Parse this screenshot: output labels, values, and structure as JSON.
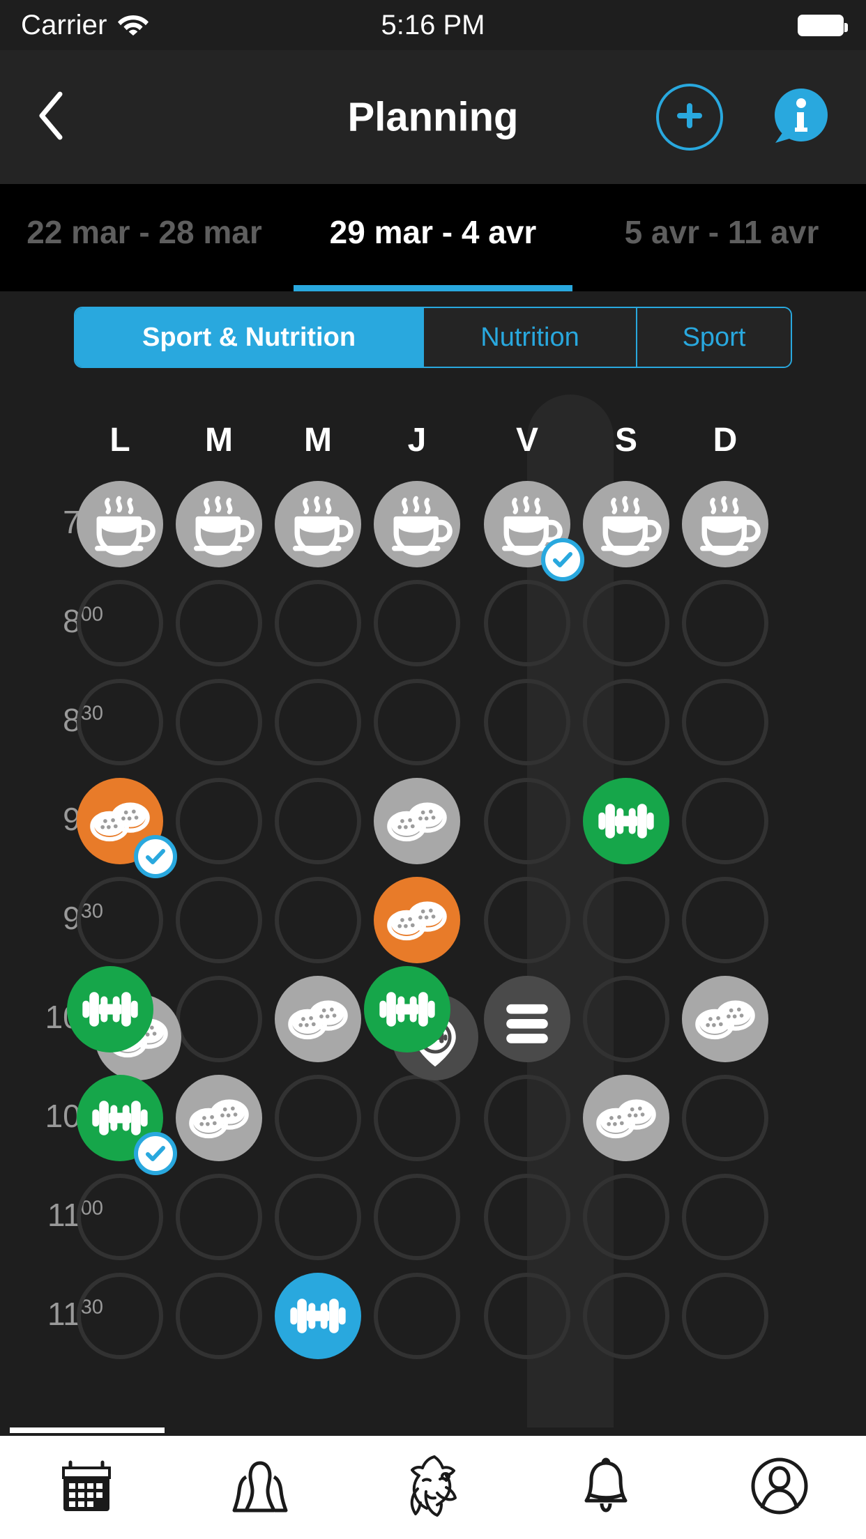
{
  "status_bar": {
    "carrier": "Carrier",
    "wifi_icon": "wifi-icon",
    "time": "5:16 PM",
    "battery_icon": "battery-full-icon"
  },
  "nav": {
    "back_icon": "chevron-left-icon",
    "title": "Planning",
    "add_icon": "plus-circle-icon",
    "info_icon": "info-bubble-icon"
  },
  "week_tabs": [
    {
      "label": "22 mar - 28 mar",
      "active": false
    },
    {
      "label": "29 mar - 4 avr",
      "active": true
    },
    {
      "label": "5 avr - 11 avr",
      "active": false
    }
  ],
  "segments": [
    {
      "label": "Sport & Nutrition",
      "active": true
    },
    {
      "label": "Nutrition",
      "active": false
    },
    {
      "label": "Sport",
      "active": false
    }
  ],
  "days": [
    {
      "label": "L",
      "today": false
    },
    {
      "label": "M",
      "today": false
    },
    {
      "label": "M",
      "today": false
    },
    {
      "label": "J",
      "today": false
    },
    {
      "label": "V",
      "today": true
    },
    {
      "label": "S",
      "today": false
    },
    {
      "label": "D",
      "today": false
    }
  ],
  "times": [
    {
      "hour": "7",
      "minutes": "30"
    },
    {
      "hour": "8",
      "minutes": "00"
    },
    {
      "hour": "8",
      "minutes": "30"
    },
    {
      "hour": "9",
      "minutes": "00"
    },
    {
      "hour": "9",
      "minutes": "30"
    },
    {
      "hour": "10",
      "minutes": "00"
    },
    {
      "hour": "10",
      "minutes": "30"
    },
    {
      "hour": "11",
      "minutes": "00"
    },
    {
      "hour": "11",
      "minutes": "30"
    }
  ],
  "colors": {
    "accent": "#29a8de",
    "meal_gray": "#a8a8a8",
    "meal_orange": "#e87b29",
    "sport_green": "#16a64a",
    "sport_blue": "#29a8de",
    "menu_dark": "#4a4a4a",
    "empty_stroke": "#323232",
    "background": "#1e1e1e",
    "navbar": "#242424",
    "weekbar": "#000000",
    "today_band": "#282828"
  },
  "events": [
    {
      "row": 0,
      "day": 0,
      "type": "coffee",
      "color": "gray",
      "checked": false
    },
    {
      "row": 0,
      "day": 1,
      "type": "coffee",
      "color": "gray",
      "checked": false
    },
    {
      "row": 0,
      "day": 2,
      "type": "coffee",
      "color": "gray",
      "checked": false
    },
    {
      "row": 0,
      "day": 3,
      "type": "coffee",
      "color": "gray",
      "checked": false
    },
    {
      "row": 0,
      "day": 4,
      "type": "coffee",
      "color": "gray",
      "checked": true
    },
    {
      "row": 0,
      "day": 5,
      "type": "coffee",
      "color": "gray",
      "checked": false
    },
    {
      "row": 0,
      "day": 6,
      "type": "coffee",
      "color": "gray",
      "checked": false
    },
    {
      "row": 3,
      "day": 0,
      "type": "meal",
      "color": "orange",
      "checked": true
    },
    {
      "row": 3,
      "day": 3,
      "type": "meal",
      "color": "gray",
      "checked": false
    },
    {
      "row": 3,
      "day": 5,
      "type": "sport",
      "color": "green",
      "checked": false
    },
    {
      "row": 4,
      "day": 3,
      "type": "meal",
      "color": "orange",
      "checked": false
    },
    {
      "row": 5,
      "day": 0,
      "type": "meal",
      "color": "gray",
      "checked": false,
      "offset": "back"
    },
    {
      "row": 5,
      "day": 0,
      "type": "sport",
      "color": "green",
      "checked": false,
      "offset": "front"
    },
    {
      "row": 5,
      "day": 2,
      "type": "meal",
      "color": "gray",
      "checked": false
    },
    {
      "row": 5,
      "day": 3,
      "type": "sportpin",
      "color": "dark",
      "checked": false,
      "offset": "back"
    },
    {
      "row": 5,
      "day": 3,
      "type": "sport",
      "color": "green",
      "checked": false,
      "offset": "front"
    },
    {
      "row": 5,
      "day": 4,
      "type": "menu",
      "color": "dark",
      "checked": false
    },
    {
      "row": 5,
      "day": 6,
      "type": "meal",
      "color": "gray",
      "checked": false
    },
    {
      "row": 6,
      "day": 0,
      "type": "sport",
      "color": "green",
      "checked": true
    },
    {
      "row": 6,
      "day": 1,
      "type": "meal",
      "color": "gray",
      "checked": false
    },
    {
      "row": 6,
      "day": 5,
      "type": "meal",
      "color": "gray",
      "checked": false
    },
    {
      "row": 8,
      "day": 2,
      "type": "sport",
      "color": "blue",
      "checked": false
    }
  ],
  "tabbar": [
    {
      "icon": "calendar-icon",
      "active": true
    },
    {
      "icon": "people-icon",
      "active": false
    },
    {
      "icon": "tiger-logo-icon",
      "active": false
    },
    {
      "icon": "bell-icon",
      "active": false
    },
    {
      "icon": "profile-icon",
      "active": false
    }
  ]
}
